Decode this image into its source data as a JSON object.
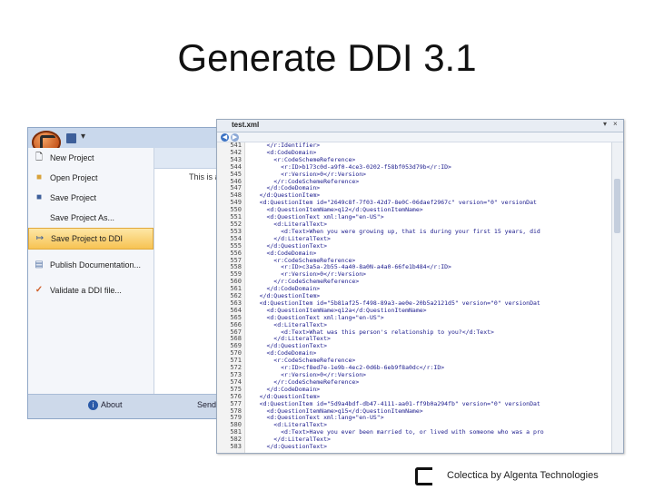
{
  "slide": {
    "title": "Generate DDI 3.1",
    "footer": "Colectica by Algenta Technologies"
  },
  "app": {
    "menu_items": [
      {
        "label": "New Project",
        "icon": "new-project-icon"
      },
      {
        "label": "Open Project",
        "icon": "open-folder-icon"
      },
      {
        "label": "Save Project",
        "icon": "save-icon"
      },
      {
        "label": "Save Project As...",
        "icon": ""
      },
      {
        "label": "Save Project to DDI",
        "icon": "save-ddi-icon",
        "active": true
      },
      {
        "label": "Publish Documentation...",
        "icon": "publish-icon"
      },
      {
        "label": "Validate a DDI file...",
        "icon": "checkmark-icon"
      }
    ],
    "right_pane_text": "This is a",
    "footer": {
      "about": "About",
      "send": "Send"
    }
  },
  "editor": {
    "tab_title": "test.xml",
    "tab_buttons": [
      "▾",
      "×"
    ],
    "lines": [
      {
        "n": "541",
        "t": "      </r:Identifier>"
      },
      {
        "n": "542",
        "t": "      <d:CodeDomain>"
      },
      {
        "n": "543",
        "t": "        <r:CodeSchemeReference>"
      },
      {
        "n": "544",
        "t": "          <r:ID>b173c0d-a9f0-4ce3-0202-f58bf053d79b</r:ID>"
      },
      {
        "n": "545",
        "t": "          <r:Version>0</r:Version>"
      },
      {
        "n": "546",
        "t": "        </r:CodeSchemeReference>"
      },
      {
        "n": "547",
        "t": "      </d:CodeDomain>"
      },
      {
        "n": "548",
        "t": "    </d:QuestionItem>"
      },
      {
        "n": "549",
        "t": "    <d:QuestionItem id=\"2649c8f-7f03-42d7-8e0C-06daef2967c\" version=\"0\" versionDat"
      },
      {
        "n": "550",
        "t": "      <d:QuestionItemName>q12</d:QuestionItemName>"
      },
      {
        "n": "551",
        "t": "      <d:QuestionText xml:lang=\"en-US\">"
      },
      {
        "n": "552",
        "t": "        <d:LiteralText>"
      },
      {
        "n": "553",
        "t": "          <d:Text>When you were growing up, that is during your first 15 years, did"
      },
      {
        "n": "554",
        "t": "        </d:LiteralText>"
      },
      {
        "n": "555",
        "t": "      </d:QuestionText>"
      },
      {
        "n": "556",
        "t": "      <d:CodeDomain>"
      },
      {
        "n": "557",
        "t": "        <r:CodeSchemeReference>"
      },
      {
        "n": "558",
        "t": "          <r:ID>c3a5a-2b55-4a40-8a0N-a4a0-66fe1b484</r:ID>"
      },
      {
        "n": "559",
        "t": "          <r:Version>0</r:Version>"
      },
      {
        "n": "560",
        "t": "        </r:CodeSchemeReference>"
      },
      {
        "n": "561",
        "t": "      </d:CodeDomain>"
      },
      {
        "n": "562",
        "t": "    </d:QuestionItem>"
      },
      {
        "n": "563",
        "t": "    <d:QuestionItem id=\"5b81af25-f498-89a3-ae0e-20b5a2121d5\" version=\"0\" versionDat"
      },
      {
        "n": "564",
        "t": "      <d:QuestionItemName>q12a</d:QuestionItemName>"
      },
      {
        "n": "565",
        "t": "      <d:QuestionText xml:lang=\"en-US\">"
      },
      {
        "n": "566",
        "t": "        <d:LiteralText>"
      },
      {
        "n": "567",
        "t": "          <d:Text>What was this person's relationship to you?</d:Text>"
      },
      {
        "n": "568",
        "t": "        </d:LiteralText>"
      },
      {
        "n": "569",
        "t": "      </d:QuestionText>"
      },
      {
        "n": "570",
        "t": "      <d:CodeDomain>"
      },
      {
        "n": "571",
        "t": "        <r:CodeSchemeReference>"
      },
      {
        "n": "572",
        "t": "          <r:ID>cf8ed7e-1e9b-4ec2-0d6b-6eb9f8a0dc</r:ID>"
      },
      {
        "n": "573",
        "t": "          <r:Version>0</r:Version>"
      },
      {
        "n": "574",
        "t": "        </r:CodeSchemeReference>"
      },
      {
        "n": "575",
        "t": "      </d:CodeDomain>"
      },
      {
        "n": "576",
        "t": "    </d:QuestionItem>"
      },
      {
        "n": "577",
        "t": "    <d:QuestionItem id=\"5d9a4bdf-db47-4111-aa01-ff9b0a294fb\" version=\"0\" versionDat"
      },
      {
        "n": "578",
        "t": "      <d:QuestionItemName>q15</d:QuestionItemName>"
      },
      {
        "n": "579",
        "t": "      <d:QuestionText xml:lang=\"en-US\">"
      },
      {
        "n": "580",
        "t": "        <d:LiteralText>"
      },
      {
        "n": "581",
        "t": "          <d:Text>Have you ever been married to, or lived with someone who was a pro"
      },
      {
        "n": "582",
        "t": "        </d:LiteralText>"
      },
      {
        "n": "583",
        "t": "      </d:QuestionText>"
      }
    ]
  },
  "colors": {
    "accent": "#f7c353",
    "editor_text": "#1a1a8c",
    "app_bg": "#d4e0ef"
  }
}
